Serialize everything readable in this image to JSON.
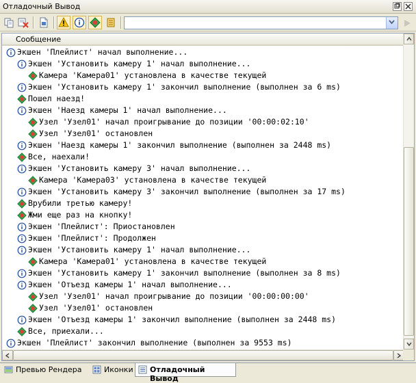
{
  "window": {
    "title": "Отладочный Вывод"
  },
  "toolbar": {
    "filter_value": ""
  },
  "list": {
    "column_header": "Сообщение",
    "rows": [
      {
        "level": 0,
        "icon": "info",
        "text": "Экшен 'Плейлист' начал выполнение..."
      },
      {
        "level": 1,
        "icon": "info",
        "text": "Экшен 'Установить камеру 1' начал выполнение..."
      },
      {
        "level": 2,
        "icon": "message",
        "text": "Камера 'Камера01' установлена в качестве текущей"
      },
      {
        "level": 1,
        "icon": "info",
        "text": "Экшен 'Установить камеру 1' закончил выполнение (выполнен за 6 ms)"
      },
      {
        "level": 1,
        "icon": "message",
        "text": "Пошел наезд!"
      },
      {
        "level": 1,
        "icon": "info",
        "text": "Экшен 'Наезд камеры 1' начал выполнение..."
      },
      {
        "level": 2,
        "icon": "message",
        "text": "Узел 'Узел01' начал проигрывание до позиции '00:00:02:10'"
      },
      {
        "level": 2,
        "icon": "message",
        "text": "Узел 'Узел01' остановлен"
      },
      {
        "level": 1,
        "icon": "info",
        "text": "Экшен 'Наезд камеры 1' закончил выполнение (выполнен за 2448 ms)"
      },
      {
        "level": 1,
        "icon": "message",
        "text": "Все, наехали!"
      },
      {
        "level": 1,
        "icon": "info",
        "text": "Экшен 'Установить камеру 3' начал выполнение..."
      },
      {
        "level": 2,
        "icon": "message",
        "text": "Камера 'Камера03' установлена в качестве текущей"
      },
      {
        "level": 1,
        "icon": "info",
        "text": "Экшен 'Установить камеру 3' закончил выполнение (выполнен за 17 ms)"
      },
      {
        "level": 1,
        "icon": "message",
        "text": "Врубили третью камеру!"
      },
      {
        "level": 1,
        "icon": "message",
        "text": "Жми еще раз на кнопку!"
      },
      {
        "level": 1,
        "icon": "info",
        "text": "Экшен 'Плейлист': Приостановлен"
      },
      {
        "level": 1,
        "icon": "info",
        "text": "Экшен 'Плейлист': Продолжен"
      },
      {
        "level": 1,
        "icon": "info",
        "text": "Экшен 'Установить камеру 1' начал выполнение..."
      },
      {
        "level": 2,
        "icon": "message",
        "text": "Камера 'Камера01' установлена в качестве текущей"
      },
      {
        "level": 1,
        "icon": "info",
        "text": "Экшен 'Установить камеру 1' закончил выполнение (выполнен за 8 ms)"
      },
      {
        "level": 1,
        "icon": "info",
        "text": "Экшен 'Отъезд камеры 1' начал выполнение..."
      },
      {
        "level": 2,
        "icon": "message",
        "text": "Узел 'Узел01' начал проигрывание до позиции '00:00:00:00'"
      },
      {
        "level": 2,
        "icon": "message",
        "text": "Узел 'Узел01' остановлен"
      },
      {
        "level": 1,
        "icon": "info",
        "text": "Экшен 'Отъезд камеры 1' закончил выполнение (выполнен за 2448 ms)"
      },
      {
        "level": 1,
        "icon": "message",
        "text": "Все, приехали..."
      },
      {
        "level": 0,
        "icon": "info",
        "text": "Экшен 'Плейлист' закончил выполнение (выполнен за 9553 ms)"
      }
    ]
  },
  "tabs": [
    {
      "label": "Превью Рендера",
      "icon": "render-preview-icon",
      "active": false
    },
    {
      "label": "Иконки",
      "icon": "icons-grid-icon",
      "active": false
    },
    {
      "label": "Отладочный Вывод",
      "icon": "debug-output-icon",
      "active": true
    }
  ],
  "colors": {
    "info": "#1f4aa8",
    "message_red": "#d8413a",
    "message_green": "#2fa84a",
    "accent_border": "#7f9db9"
  }
}
